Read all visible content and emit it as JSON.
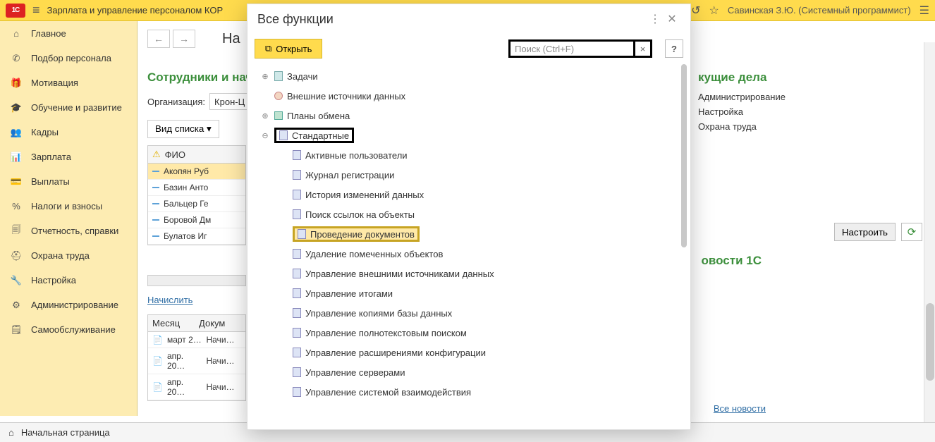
{
  "topbar": {
    "app_title": "Зарплата и управление персоналом КОР",
    "user": "Савинская З.Ю. (Системный программист)"
  },
  "sidebar": {
    "items": [
      {
        "icon": "home-icon",
        "glyph": "⌂",
        "label": "Главное"
      },
      {
        "icon": "phone-icon",
        "glyph": "✆",
        "label": "Подбор персонала"
      },
      {
        "icon": "gift-icon",
        "glyph": "🎁",
        "label": "Мотивация"
      },
      {
        "icon": "graduation-icon",
        "glyph": "🎓",
        "label": "Обучение и развитие"
      },
      {
        "icon": "people-icon",
        "glyph": "👥",
        "label": "Кадры"
      },
      {
        "icon": "money-icon",
        "glyph": "📊",
        "label": "Зарплата"
      },
      {
        "icon": "wallet-icon",
        "glyph": "💳",
        "label": "Выплаты"
      },
      {
        "icon": "percent-icon",
        "glyph": "%",
        "label": "Налоги и взносы"
      },
      {
        "icon": "report-icon",
        "glyph": "🗐",
        "label": "Отчетность, справки"
      },
      {
        "icon": "safety-icon",
        "glyph": "⛑",
        "label": "Охрана труда"
      },
      {
        "icon": "wrench-icon",
        "glyph": "🔧",
        "label": "Настройка"
      },
      {
        "icon": "gear-icon",
        "glyph": "⚙",
        "label": "Администрирование"
      },
      {
        "icon": "self-icon",
        "glyph": "🗒",
        "label": "Самообслуживание"
      }
    ]
  },
  "taskbar": {
    "start_page": "Начальная страница"
  },
  "background": {
    "title_partial": "На",
    "section_title": "Сотрудники и нач",
    "org_label": "Организация:",
    "org_value": "Крон-Ц",
    "view_label": "Вид списка ▾",
    "table_header": "ФИО",
    "employees": [
      "Акопян Руб",
      "Базин Анто",
      "Бальцер Ге",
      "Боровой Дм",
      "Булатов Иг"
    ],
    "accrue_link": "Начислить",
    "docs_header_month": "Месяц",
    "docs_header_doc": "Докум",
    "docs_rows": [
      {
        "month": "март 2…",
        "doc": "Начи…"
      },
      {
        "month": "апр. 20…",
        "doc": "Начи…"
      },
      {
        "month": "апр. 20…",
        "doc": "Начи…"
      }
    ],
    "right_title": "кущие дела",
    "right_links": [
      "Администрирование",
      "Настройка",
      "Охрана труда"
    ],
    "configure_btn": "Настроить",
    "news_title": "овости 1С",
    "all_news": "Все новости"
  },
  "modal": {
    "title": "Все функции",
    "open_btn": "Открыть",
    "search_placeholder": "Поиск (Ctrl+F)",
    "help": "?",
    "tree": {
      "top": [
        {
          "label": "Задачи",
          "expandable": true,
          "icon": "doc"
        },
        {
          "label": "Внешние источники данных",
          "expandable": false,
          "icon": "db"
        },
        {
          "label": "Планы обмена",
          "expandable": true,
          "icon": "plan"
        }
      ],
      "standard_label": "Стандартные",
      "standard_children": [
        "Активные пользователи",
        "Журнал регистрации",
        "История изменений данных",
        "Поиск ссылок на объекты",
        "Проведение документов",
        "Удаление помеченных объектов",
        "Управление внешними источниками данных",
        "Управление итогами",
        "Управление копиями базы данных",
        "Управление полнотекстовым поиском",
        "Управление расширениями конфигурации",
        "Управление серверами",
        "Управление системой взаимодействия"
      ],
      "highlighted_child": "Проведение документов"
    }
  }
}
